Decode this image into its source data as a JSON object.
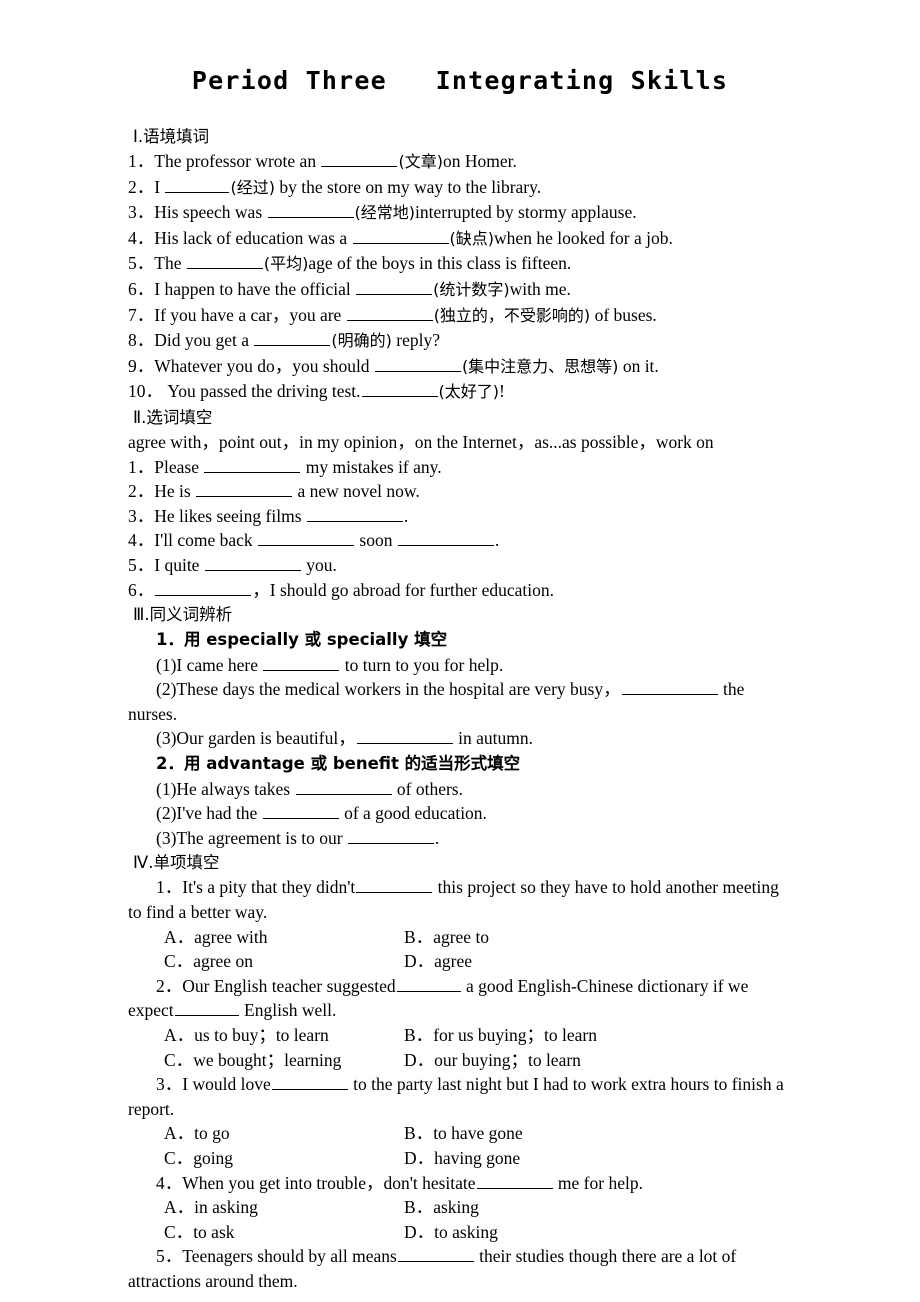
{
  "title": "Period Three   Integrating Skills",
  "sections": {
    "s1": {
      "heading": "Ⅰ.语境填词",
      "items": [
        {
          "num": "1．",
          "pre": "The professor wrote an ",
          "hint": "(文章)",
          "post": "on Homer."
        },
        {
          "num": "2．",
          "pre": "I ",
          "hint": "(经过)",
          "post": " by the store on my way to the library."
        },
        {
          "num": "3．",
          "pre": "His speech was ",
          "hint": "(经常地)",
          "post": "interrupted by stormy applause."
        },
        {
          "num": "4．",
          "pre": "His lack of education was a ",
          "hint": "(缺点)",
          "post": "when he looked for a job."
        },
        {
          "num": "5．",
          "pre": "The ",
          "hint": "(平均)",
          "post": "age of the boys in this class is fifteen."
        },
        {
          "num": "6．",
          "pre": "I happen to have the official ",
          "hint": "(统计数字)",
          "post": "with me."
        },
        {
          "num": "7．",
          "pre": "If you have a car，you are ",
          "hint": "(独立的，不受影响的)",
          "post": " of buses."
        },
        {
          "num": "8．",
          "pre": "Did you get a ",
          "hint": "(明确的)",
          "post": " reply?"
        },
        {
          "num": "9．",
          "pre": "Whatever you do，you should ",
          "hint": "(集中注意力、思想等)",
          "post": " on it."
        },
        {
          "num": "10．",
          "pre": "You passed the driving test.",
          "hint": "(太好了)",
          "post": "!"
        }
      ]
    },
    "s2": {
      "heading": "Ⅱ.选词填空",
      "wordbank": "agree with，point out，in my opinion，on the Internet，as...as possible，work on",
      "items": [
        {
          "num": "1．",
          "pre": "Please ",
          "post": " my mistakes if any."
        },
        {
          "num": "2．",
          "pre": "He is ",
          "post": " a new novel now."
        },
        {
          "num": "3．",
          "pre": "He likes seeing films ",
          "post": "."
        },
        {
          "num": "4．",
          "pre": "I'll come back ",
          "mid": " soon ",
          "post": "."
        },
        {
          "num": "5．",
          "pre": "I quite ",
          "post": " you."
        },
        {
          "num": "6．",
          "pre": "",
          "post": "，I should go abroad for further education."
        }
      ]
    },
    "s3": {
      "heading": "Ⅲ.同义词辨析",
      "group1": {
        "head": "1．用 especially 或 specially 填空",
        "items": [
          {
            "num": "(1)",
            "pre": "I came here ",
            "post": " to turn to you for help."
          },
          {
            "num": "(2)",
            "pre": "These days the medical workers in the hospital are very busy，",
            "post": " the nurses."
          },
          {
            "num": "(3)",
            "pre": "Our garden is beautiful，",
            "post": " in autumn."
          }
        ]
      },
      "group2": {
        "head": "2．用 advantage 或 benefit 的适当形式填空",
        "items": [
          {
            "num": "(1)",
            "pre": "He always takes ",
            "post": " of others."
          },
          {
            "num": "(2)",
            "pre": "I've had the ",
            "post": " of a good education."
          },
          {
            "num": "(3)",
            "pre": "The agreement is to our ",
            "post": "."
          }
        ]
      }
    },
    "s4": {
      "heading": "Ⅳ.单项填空",
      "questions": [
        {
          "num": "1．",
          "pre": "It's a pity that they didn't",
          "post": " this project so they have to hold another meeting to find a better way.",
          "options": [
            {
              "label": "A．",
              "text": "agree with"
            },
            {
              "label": "B．",
              "text": "agree to"
            },
            {
              "label": "C．",
              "text": "agree on"
            },
            {
              "label": "D．",
              "text": "agree"
            }
          ]
        },
        {
          "num": "2．",
          "pre": "Our English teacher suggested",
          "mid": " a good English-Chinese dictionary if we expect",
          "post": " English well.",
          "options": [
            {
              "label": "A．",
              "text": "us to buy；to learn"
            },
            {
              "label": "B．",
              "text": "for us buying；to learn"
            },
            {
              "label": "C．",
              "text": "we bought；learning"
            },
            {
              "label": "D．",
              "text": "our buying；to learn"
            }
          ]
        },
        {
          "num": "3．",
          "pre": "I would love",
          "post": " to the party last night but I had to work extra hours to finish a report.",
          "options": [
            {
              "label": "A．",
              "text": "to go"
            },
            {
              "label": "B．",
              "text": "to have gone"
            },
            {
              "label": "C．",
              "text": "going"
            },
            {
              "label": "D．",
              "text": "having gone"
            }
          ]
        },
        {
          "num": "4．",
          "pre": "When you get into trouble，don't hesitate",
          "post": " me for help.",
          "options": [
            {
              "label": "A．",
              "text": "in asking"
            },
            {
              "label": "B．",
              "text": "asking"
            },
            {
              "label": "C．",
              "text": "to ask"
            },
            {
              "label": "D．",
              "text": "to asking"
            }
          ]
        },
        {
          "num": "5．",
          "pre": "Teenagers should by all means",
          "post": " their studies though there are a lot of attractions around them.",
          "options": []
        }
      ]
    }
  }
}
